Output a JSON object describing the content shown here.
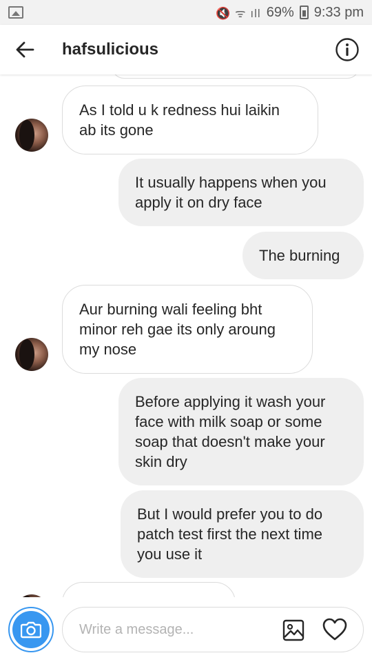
{
  "status_bar": {
    "signal_text": "🔇 ᯤ ıll",
    "battery_percent": "69%",
    "time": "9:33 pm"
  },
  "header": {
    "title": "hafsulicious"
  },
  "messages": [
    {
      "direction": "in",
      "text": "As I told u k redness hui laikin\nab its gone"
    },
    {
      "direction": "out",
      "text": "It usually happens when you\napply it on dry face"
    },
    {
      "direction": "out",
      "text": "The burning"
    },
    {
      "direction": "in",
      "text": "Aur burning wali feeling bht\nminor reh gae its only aroung\nmy nose"
    },
    {
      "direction": "out",
      "text": "Before applying it wash your\nface with milk soap or some\nsoap that doesn't make your\nskin dry"
    },
    {
      "direction": "out",
      "text": "But I would prefer you to do\npatch test first the next time\nyou use it"
    }
  ],
  "composer": {
    "placeholder": "Write a message..."
  },
  "colors": {
    "accent": "#3897f0",
    "outgoing_bubble": "#efefef",
    "incoming_border": "#dbdbdb"
  },
  "icons": [
    "gallery-status-icon",
    "back-arrow-icon",
    "info-icon",
    "camera-icon",
    "gallery-icon",
    "heart-icon"
  ]
}
